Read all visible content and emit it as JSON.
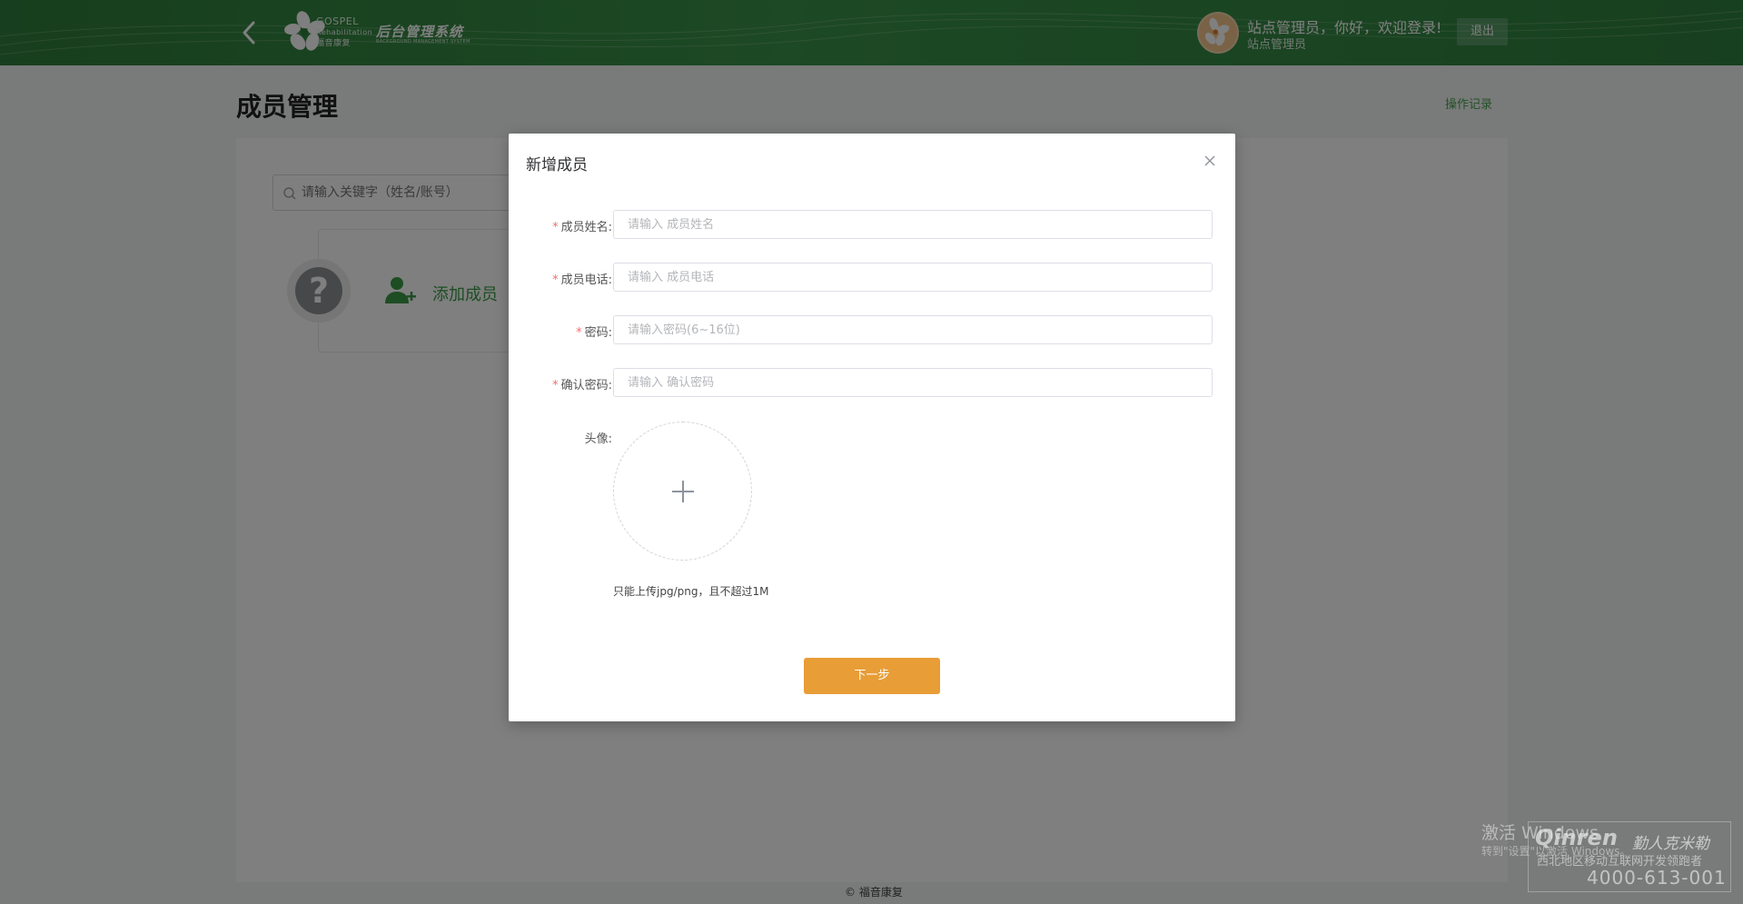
{
  "header": {
    "brand_line1": "GOSPEL",
    "brand_line2": "Rehabilitation",
    "brand_line3": "福音康复",
    "system_title": "后台管理系统",
    "system_subtitle": "BACKGROUND MANAGEMENT SYSTEM",
    "welcome_text": "站点管理员，你好，欢迎登录!",
    "role_text": "站点管理员",
    "logout_label": "退出"
  },
  "page": {
    "title": "成员管理",
    "operation_log_label": "操作记录",
    "search_placeholder": "请输入关键字（姓名/账号）",
    "add_member_label": "添加成员",
    "help_symbol": "?"
  },
  "modal": {
    "title": "新增成员",
    "fields": [
      {
        "label": "成员姓名:",
        "placeholder": "请输入 成员姓名",
        "required": true
      },
      {
        "label": "成员电话:",
        "placeholder": "请输入 成员电话",
        "required": true
      },
      {
        "label": "密码:",
        "placeholder": "请输入密码(6~16位)",
        "required": true
      },
      {
        "label": "确认密码:",
        "placeholder": "请输入 确认密码",
        "required": true
      }
    ],
    "required_mark": "*",
    "avatar_label": "头像:",
    "upload_tip": "只能上传jpg/png，且不超过1M",
    "next_button_label": "下一步"
  },
  "footer": {
    "copyright": "© 福音康复"
  },
  "watermarks": {
    "windows_activate": "激活 Windows",
    "windows_activate_sub": "转到\"设置\"以激活 Windows。",
    "qinren_brand": "Qinren",
    "qinren_brand_cn": "勤人克米勒",
    "qinren_slogan": "西北地区移动互联网开发领跑者",
    "qinren_phone": "4000-613-001"
  },
  "colors": {
    "header_green": "#2e7d3c",
    "accent_green": "#47a54f",
    "primary_orange": "#e89d37",
    "required_red": "#f56c6c"
  },
  "icons": {
    "back": "chevron-left-icon",
    "search": "search-icon",
    "close": "close-icon",
    "add_user": "add-user-icon",
    "help": "question-icon",
    "upload": "plus-icon"
  }
}
